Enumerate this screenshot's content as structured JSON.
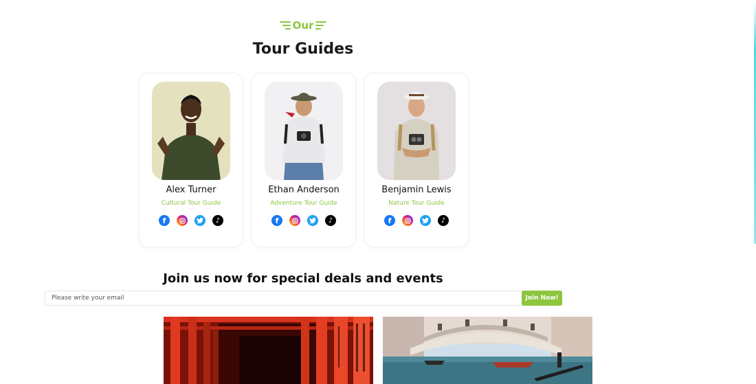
{
  "section": {
    "eyebrow": "Our",
    "title": "Tour Guides"
  },
  "guides": [
    {
      "name": "Alex Turner",
      "role": "Cultural Tour Guide",
      "socials": [
        "facebook-icon",
        "instagram-icon",
        "twitter-icon",
        "tiktok-icon"
      ]
    },
    {
      "name": "Ethan Anderson",
      "role": "Adventure Tour Guide",
      "socials": [
        "facebook-icon",
        "instagram-icon",
        "twitter-icon",
        "tiktok-icon"
      ]
    },
    {
      "name": "Benjamin Lewis",
      "role": "Nature Tour Guide",
      "socials": [
        "facebook-icon",
        "instagram-icon",
        "twitter-icon",
        "tiktok-icon"
      ]
    }
  ],
  "newsletter": {
    "title": "Join us now for special deals and events",
    "placeholder": "Please write your email",
    "button_label": "Join Now!"
  },
  "colors": {
    "accent": "#8cc63f",
    "facebook": "#1877f2",
    "twitter": "#1da1f2",
    "tiktok": "#000000"
  }
}
